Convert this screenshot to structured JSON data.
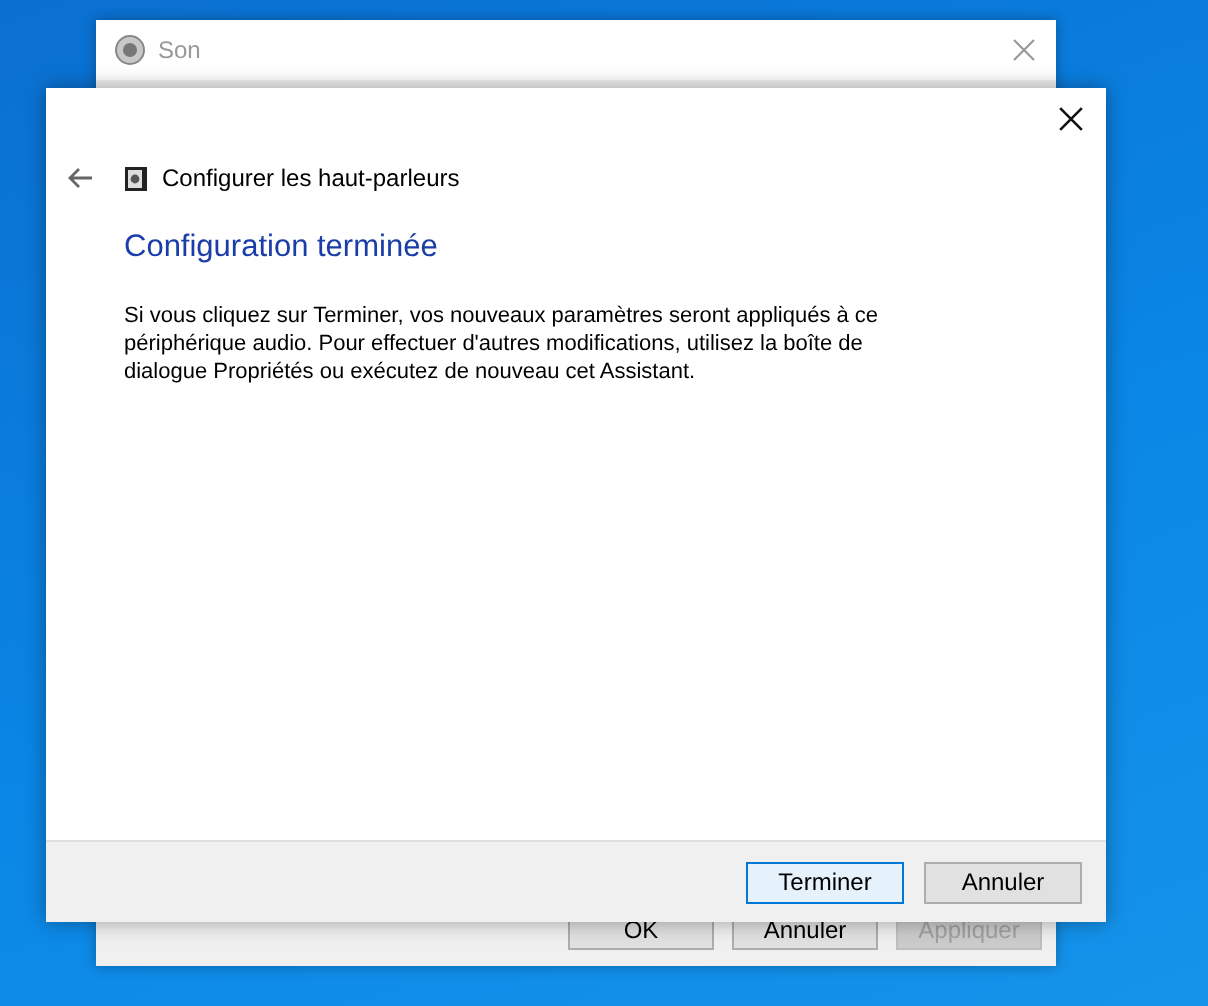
{
  "background_window": {
    "title": "Son",
    "buttons": [
      {
        "label": "OK",
        "disabled": false
      },
      {
        "label": "Annuler",
        "disabled": false
      },
      {
        "label": "Appliquer",
        "disabled": true
      }
    ]
  },
  "wizard": {
    "title": "Configurer les haut-parleurs",
    "heading": "Configuration terminée",
    "body": "Si vous cliquez sur Terminer, vos nouveaux paramètres seront appliqués à ce périphérique audio. Pour effectuer d'autres modifications, utilisez la boîte de dialogue Propriétés ou exécutez de nouveau cet Assistant.",
    "buttons": [
      {
        "label": "Terminer",
        "default": true
      },
      {
        "label": "Annuler",
        "default": false
      }
    ]
  }
}
